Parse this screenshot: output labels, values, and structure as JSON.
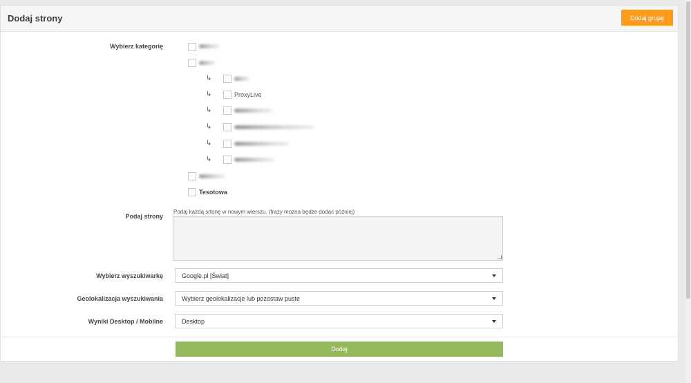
{
  "header": {
    "title": "Dodaj strony",
    "add_group_label": "Dodaj grupę"
  },
  "labels": {
    "category": "Wybierz kategorię",
    "pages": "Podaj strony",
    "engine": "Wybierz wyszukiwarkę",
    "geo": "Geolokalizacja wyszukiwania",
    "device": "Wyniki Desktop / Mobilne"
  },
  "categories": {
    "proxylive": "ProxyLive",
    "tesotowa": "Tesotowa",
    "sub_arrow": "↳"
  },
  "pages_hint": "Podaj każdą srtonę w nowym wierszu. (frazy mozna będze dodać później)",
  "selects": {
    "engine": "Google.pl [Świat]",
    "geo": "Wybierz geolokalizacje lub pozostaw puste",
    "device": "Desktop"
  },
  "submit_label": "Dodaj",
  "colors": {
    "accent_orange": "#ff9a1a",
    "submit_green": "#93b95c"
  }
}
